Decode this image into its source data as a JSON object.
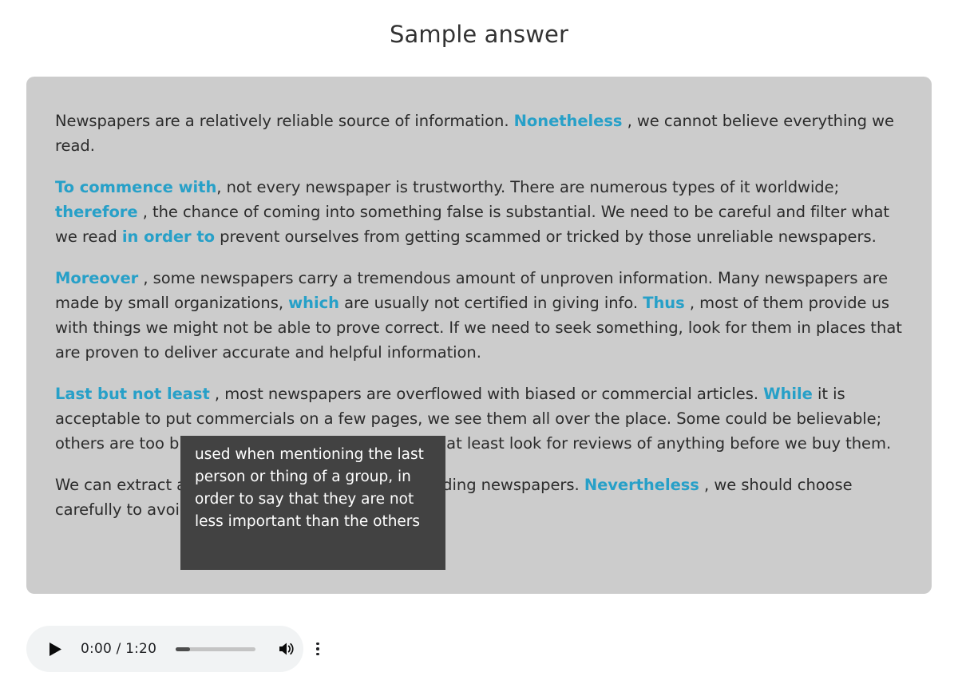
{
  "page": {
    "title": "Sample answer"
  },
  "answer": {
    "paragraphs": [
      {
        "id": "paragraph-1",
        "runs": [
          {
            "text": "Newspapers are a relatively reliable source of information. ",
            "kw": false
          },
          {
            "text": "Nonetheless",
            "kw": true
          },
          {
            "text": " , we cannot believe everything we read.",
            "kw": false
          }
        ]
      },
      {
        "id": "paragraph-2",
        "runs": [
          {
            "text": "To commence with",
            "kw": true
          },
          {
            "text": ", not every newspaper is trustworthy. There are numerous types of it worldwide; ",
            "kw": false
          },
          {
            "text": "therefore",
            "kw": true
          },
          {
            "text": " , the chance of coming into something false is substantial. We need to be careful and filter what we read ",
            "kw": false
          },
          {
            "text": "in order to",
            "kw": true
          },
          {
            "text": " prevent ourselves from getting scammed or tricked by those unreliable newspapers.",
            "kw": false
          }
        ]
      },
      {
        "id": "paragraph-3",
        "runs": [
          {
            "text": "Moreover",
            "kw": true
          },
          {
            "text": " , some newspapers carry a tremendous amount of unproven information. Many newspapers are made by small organizations, ",
            "kw": false
          },
          {
            "text": "which",
            "kw": true
          },
          {
            "text": " are usually not certified in giving info. ",
            "kw": false
          },
          {
            "text": "Thus",
            "kw": true
          },
          {
            "text": " , most of them provide us with things we might not be able to prove correct. If we need to seek something, look for them in places that are proven to deliver accurate and helpful information.",
            "kw": false
          }
        ]
      },
      {
        "id": "paragraph-4",
        "runs": [
          {
            "text": "Last but not least",
            "kw": true
          },
          {
            "text": " , most newspapers are overflowed with biased or commercial articles. ",
            "kw": false
          },
          {
            "text": "While",
            "kw": true
          },
          {
            "text": " it is acceptable to put commercials on a few pages, we see them all over the place. Some could be believable; others are too bizarre to believe. We should try or at least look for reviews of anything before we buy them.",
            "kw": false
          }
        ]
      },
      {
        "id": "paragraph-5",
        "runs": [
          {
            "text": "We can extract a lot of useful knowledge from reading newspapers. ",
            "kw": false
          },
          {
            "text": "Nevertheless",
            "kw": true
          },
          {
            "text": " , we should choose carefully to avoid false information.",
            "kw": false
          }
        ]
      }
    ]
  },
  "tooltip": {
    "text": "used when mentioning the last person or thing of a group, in order to say that they are not less important than the others",
    "background_color": "#424242",
    "text_color": "#ffffff"
  },
  "audio_player": {
    "play_icon": "play-icon",
    "time": "0:00 / 1:20",
    "current_time": "0:00",
    "duration": "1:20",
    "progress_percent": 18,
    "volume_icon": "volume-on-icon",
    "menu_icon": "more-vertical-icon"
  },
  "colors": {
    "accent": "#27a0c8",
    "panel_background": "#cccccc",
    "page_background": "#ffffff",
    "body_text": "#2b2b2b",
    "player_background": "#f1f3f4"
  }
}
